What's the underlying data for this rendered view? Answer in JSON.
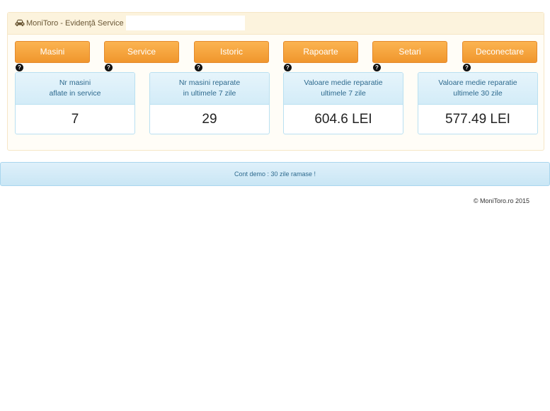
{
  "header": {
    "title": "MoniToro - Evidenţă Service -",
    "icon": "car-icon"
  },
  "nav": [
    {
      "label": "Masini"
    },
    {
      "label": "Service"
    },
    {
      "label": "Istoric"
    },
    {
      "label": "Rapoarte"
    },
    {
      "label": "Setari"
    },
    {
      "label": "Deconectare"
    }
  ],
  "help_label": "?",
  "stats": [
    {
      "line1": "Nr masini",
      "line2": "aflate in service",
      "value": "7"
    },
    {
      "line1": "Nr masini reparate",
      "line2": "in ultimele 7 zile",
      "value": "29"
    },
    {
      "line1": "Valoare medie reparatie",
      "line2": "ultimele 7 zile",
      "value": "604.6 LEI"
    },
    {
      "line1": "Valoare medie reparatie",
      "line2": "ultimele 30 zile",
      "value": "577.49 LEI"
    }
  ],
  "alert": {
    "text": "Cont demo : 30 zile ramase !"
  },
  "footer": {
    "text": "© MoniToro.ro 2015"
  },
  "colors": {
    "accent": "#f0962d",
    "info_bg": "#d3ecf8",
    "info_text": "#2e6a8e"
  }
}
